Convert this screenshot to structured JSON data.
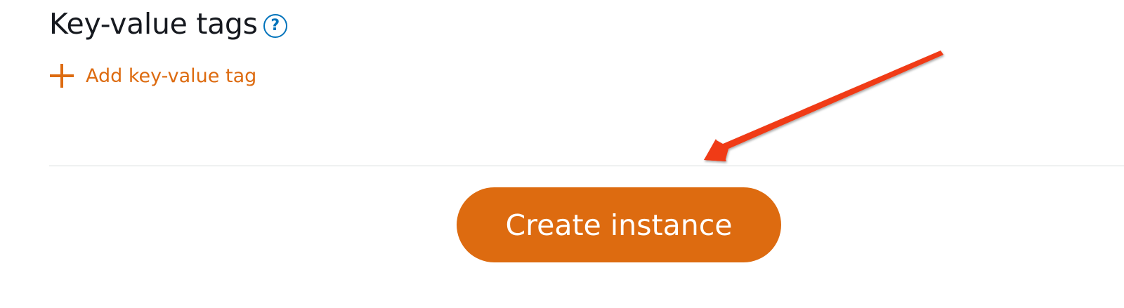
{
  "tags_section": {
    "title": "Key-value tags",
    "help_icon": "help-circle-icon",
    "help_glyph": "?",
    "add_tag_icon": "plus-icon",
    "add_tag_label": "Add key-value tag"
  },
  "actions": {
    "create_label": "Create instance"
  },
  "annotation": {
    "icon": "red-arrow-icon",
    "color": "#f03a17"
  },
  "colors": {
    "accent": "#dd6b10",
    "link_blue": "#0073bb",
    "divider": "#d5dbdb",
    "text": "#16191f"
  }
}
